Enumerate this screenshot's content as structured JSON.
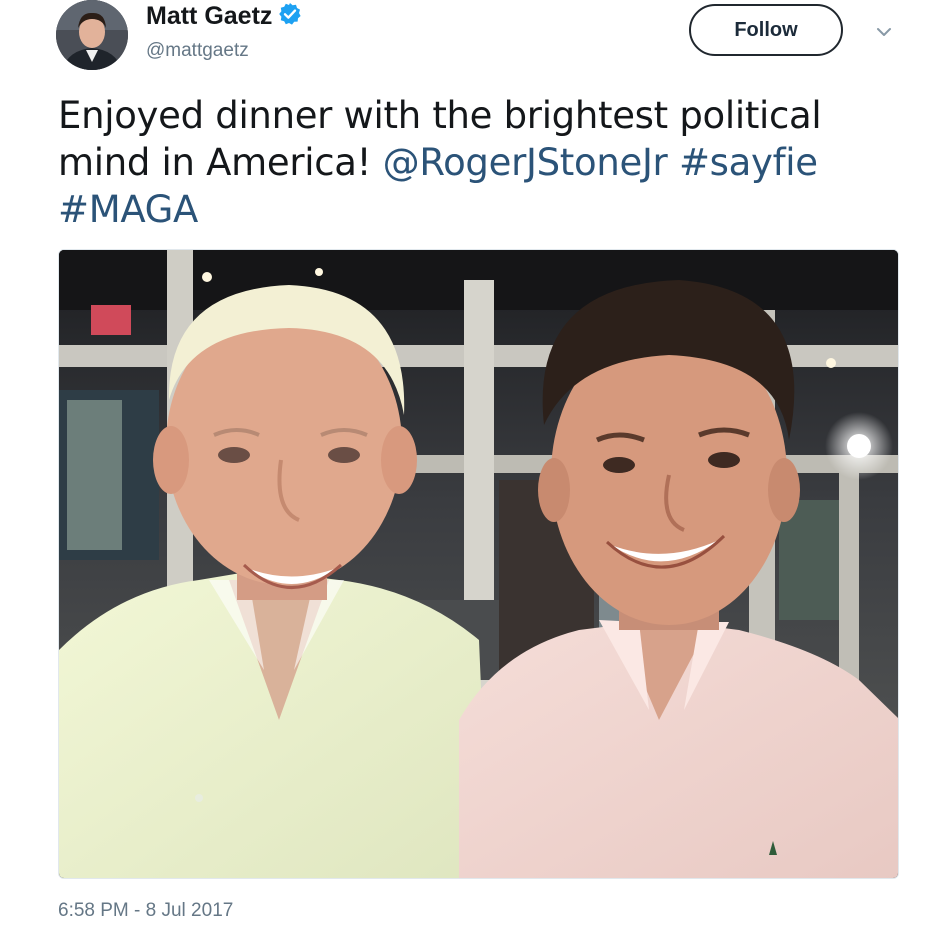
{
  "author": {
    "display_name": "Matt Gaetz",
    "handle": "@mattgaetz",
    "verified": true,
    "avatar_icon": "profile-photo"
  },
  "actions": {
    "follow_label": "Follow",
    "more_icon": "chevron-down-icon"
  },
  "tweet": {
    "text_plain": "Enjoyed dinner with the brightest political mind in America! ",
    "mention": "@RogerJStoneJr",
    "hashtag_1": "#sayfie",
    "hashtag_2": "#MAGA",
    "photo_icon": "selfie-photo"
  },
  "meta": {
    "timestamp": "6:58 PM - 8 Jul 2017"
  },
  "colors": {
    "text": "#14171a",
    "secondary": "#657786",
    "link": "#2b5378",
    "verified": "#1da1f2"
  }
}
